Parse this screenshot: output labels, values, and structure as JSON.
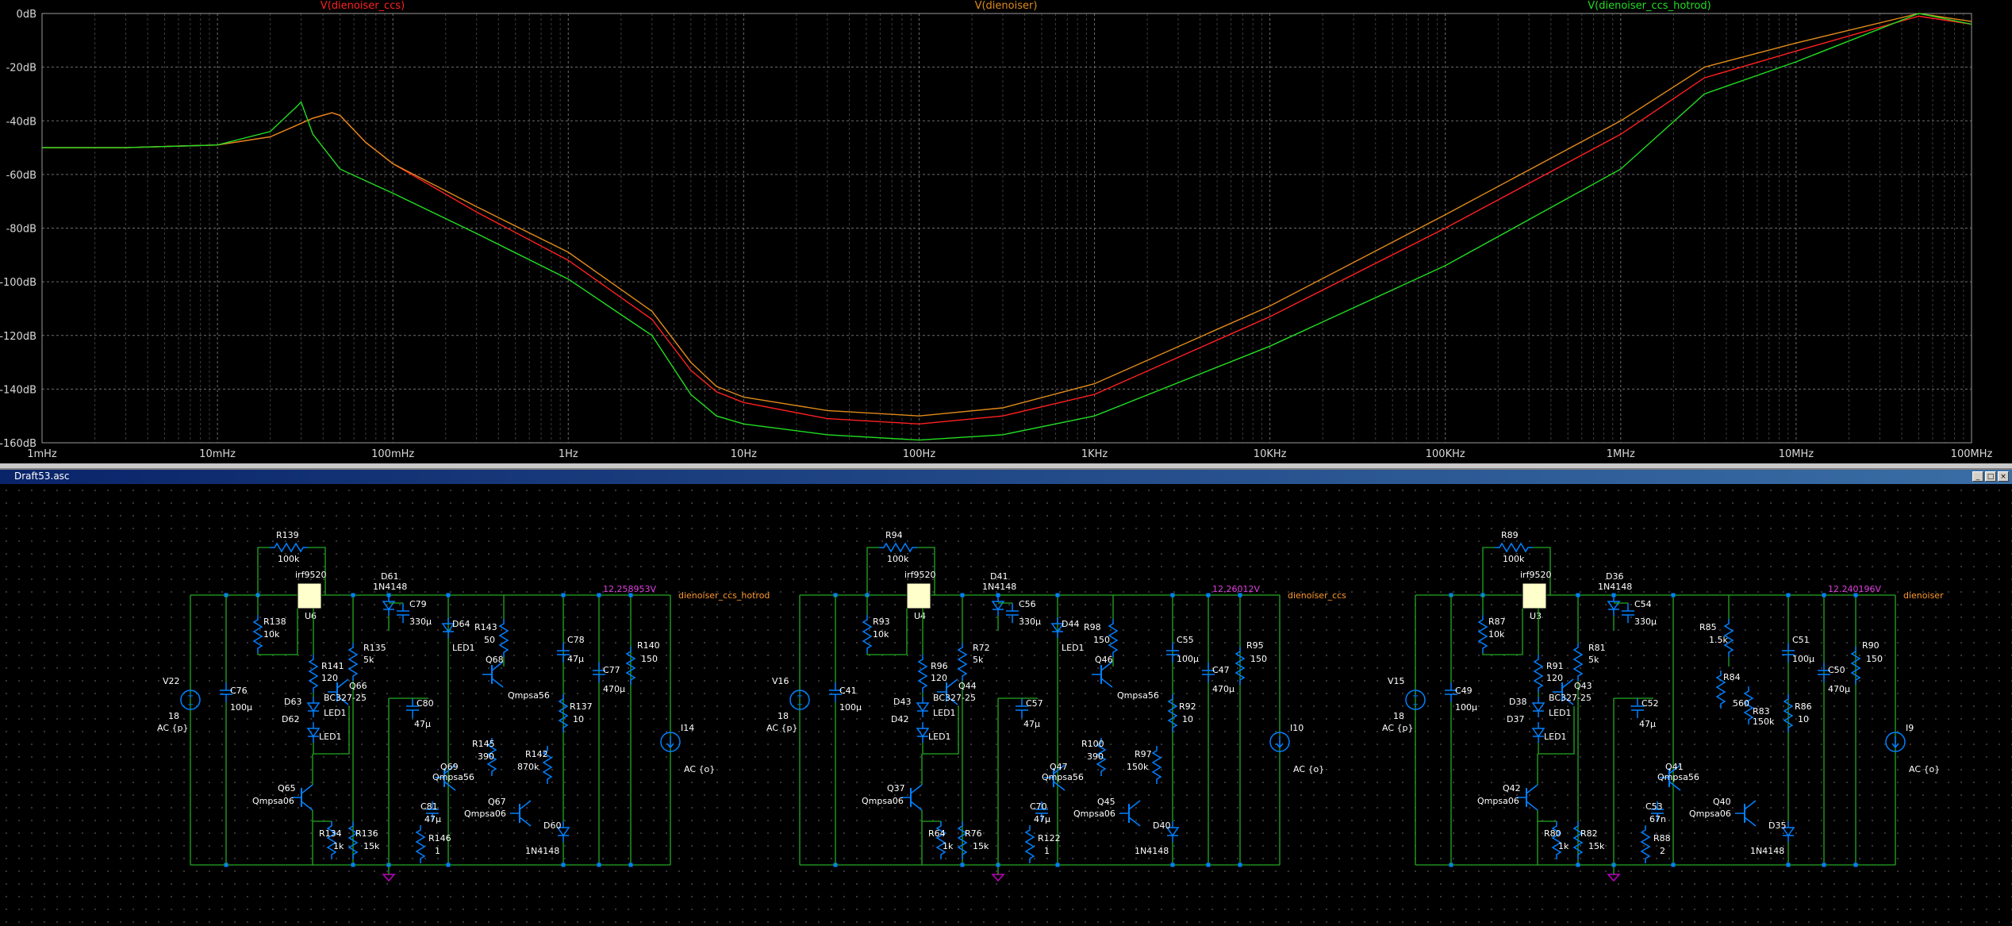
{
  "plot": {
    "traces": [
      {
        "name": "V(dienoiser_ccs)",
        "color": "#ff2020"
      },
      {
        "name": "V(dienoiser)",
        "color": "#e08a1a"
      },
      {
        "name": "V(dienoiser_ccs_hotrod)",
        "color": "#22dd22"
      }
    ],
    "y_ticks": [
      "0dB",
      "-20dB",
      "-40dB",
      "-60dB",
      "-80dB",
      "-100dB",
      "-120dB",
      "-140dB",
      "-160dB"
    ],
    "x_ticks": [
      "1mHz",
      "10mHz",
      "100mHz",
      "1Hz",
      "10Hz",
      "100Hz",
      "1KHz",
      "10KHz",
      "100KHz",
      "1MHz",
      "10MHz",
      "100MHz"
    ]
  },
  "chart_data": {
    "type": "line",
    "title": "",
    "xlabel": "",
    "ylabel": "",
    "x_scale": "log",
    "xlim": [
      "1mHz",
      "100MHz"
    ],
    "ylim": [
      -160,
      0
    ],
    "grid": true,
    "series": [
      {
        "name": "V(dienoiser_ccs)",
        "color": "#ff2020",
        "x": [
          0.001,
          0.003,
          0.01,
          0.02,
          0.035,
          0.045,
          0.05,
          0.07,
          0.1,
          0.3,
          1,
          3,
          5,
          7,
          10,
          30,
          100,
          300,
          1000,
          10000,
          100000,
          1000000,
          3000000,
          10000000,
          50000000,
          100000000
        ],
        "y": [
          -50,
          -50,
          -49,
          -46,
          -39,
          -37,
          -38,
          -48,
          -56,
          -74,
          -92,
          -114,
          -133,
          -141,
          -145,
          -151,
          -153,
          -150,
          -142,
          -113,
          -80,
          -45,
          -24,
          -14,
          -1,
          -4
        ]
      },
      {
        "name": "V(dienoiser)",
        "color": "#e08a1a",
        "x": [
          0.001,
          0.003,
          0.01,
          0.02,
          0.035,
          0.045,
          0.05,
          0.07,
          0.1,
          0.3,
          1,
          3,
          5,
          7,
          10,
          30,
          100,
          300,
          1000,
          10000,
          100000,
          1000000,
          3000000,
          10000000,
          50000000,
          100000000
        ],
        "y": [
          -50,
          -50,
          -49,
          -46,
          -39,
          -37,
          -38,
          -48,
          -56,
          -72,
          -89,
          -111,
          -130,
          -139,
          -143,
          -148,
          -150,
          -147,
          -138,
          -109,
          -75,
          -40,
          -20,
          -11,
          0,
          -3
        ]
      },
      {
        "name": "V(dienoiser_ccs_hotrod)",
        "color": "#22dd22",
        "x": [
          0.001,
          0.003,
          0.01,
          0.02,
          0.028,
          0.03,
          0.035,
          0.05,
          0.1,
          0.3,
          1,
          3,
          5,
          7,
          10,
          30,
          100,
          300,
          1000,
          10000,
          100000,
          1000000,
          3000000,
          10000000,
          50000000,
          100000000
        ],
        "y": [
          -50,
          -50,
          -49,
          -44,
          -35,
          -33,
          -45,
          -58,
          -67,
          -82,
          -99,
          -120,
          -142,
          -150,
          -153,
          -157,
          -159,
          -157,
          -150,
          -124,
          -94,
          -58,
          -30,
          -18,
          0,
          -4
        ]
      }
    ]
  },
  "window": {
    "title": "Draft53.asc",
    "min": "_",
    "restore": "□",
    "close": "×"
  },
  "circuits": [
    {
      "vsrc": "V22",
      "vsrc_val": "18",
      "vsrc_ac": "AC {p}",
      "rf": "R139",
      "rf_val": "100k",
      "mos": "irf9520",
      "mos_ref": "U6",
      "diode_top": "D61",
      "diode_top_val": "1N4148",
      "cin": "C76",
      "cin_val": "100μ",
      "rg": "R138",
      "rg_val": "10k",
      "r2": "R141",
      "r2_val": "120",
      "qp": "Q66",
      "qp_val": "BC327-25",
      "led_a": "D63",
      "led_a_val": "LED1",
      "led_b": "D62",
      "led_b_val": "LED1",
      "qn": "Q65",
      "qn_val": "Qmpsa06",
      "r_lo1": "R134",
      "r_lo1_val": "1k",
      "r_lo2": "R136",
      "r_lo2_val": "15k",
      "c_sup": "C79",
      "c_sup_val": "330μ",
      "r_sup": "R135",
      "r_sup_val": "5k",
      "c_mid": "C80",
      "c_mid_val": "47μ",
      "led_c": "D64",
      "led_c_val": "LED1",
      "r_top": "R143",
      "r_top_val": "50",
      "q_top": "Q68",
      "q_top_val": "Qmpsa56",
      "q_l": "Q69",
      "q_l_val": "Qmpsa56",
      "r_m1": "R145",
      "r_m1_val": "390",
      "r_m2": "R142",
      "r_m2_val": "870k",
      "q_r": "Q67",
      "q_r_val": "Qmpsa06",
      "c_lo": "C81",
      "c_lo_val": "47μ",
      "r_lo3": "R146",
      "r_lo3_val": "1",
      "d_out": "D60",
      "d_out_val": "1N4148",
      "c_o1": "C78",
      "c_o1_val": "47μ",
      "r_o1": "R137",
      "r_o1_val": "10",
      "c_o2": "C77",
      "c_o2_val": "470μ",
      "r_o2": "R140",
      "r_o2_val": "150",
      "isrc": "I14",
      "isrc_ac": "AC {o}",
      "vout": "12.258953V",
      "net": "dienoiser_ccs_hotrod"
    },
    {
      "vsrc": "V16",
      "vsrc_val": "18",
      "vsrc_ac": "AC {p}",
      "rf": "R94",
      "rf_val": "100k",
      "mos": "irf9520",
      "mos_ref": "U4",
      "diode_top": "D41",
      "diode_top_val": "1N4148",
      "cin": "C41",
      "cin_val": "100μ",
      "rg": "R93",
      "rg_val": "10k",
      "r2": "R96",
      "r2_val": "120",
      "qp": "Q44",
      "qp_val": "BC327-25",
      "led_a": "D43",
      "led_a_val": "LED1",
      "led_b": "D42",
      "led_b_val": "LED1",
      "qn": "Q37",
      "qn_val": "Qmpsa06",
      "r_lo1": "R64",
      "r_lo1_val": "1k",
      "r_lo2": "R76",
      "r_lo2_val": "15k",
      "c_sup": "C56",
      "c_sup_val": "330μ",
      "r_sup": "R72",
      "r_sup_val": "5k",
      "c_mid": "C57",
      "c_mid_val": "47μ",
      "led_c": "D44",
      "led_c_val": "LED1",
      "r_top": "R98",
      "r_top_val": "150",
      "q_top": "Q46",
      "q_top_val": "Qmpsa56",
      "q_l": "Q47",
      "q_l_val": "Qmpsa56",
      "r_m1": "R100",
      "r_m1_val": "390",
      "r_m2": "R97",
      "r_m2_val": "150k",
      "q_r": "Q45",
      "q_r_val": "Qmpsa06",
      "c_lo": "C70",
      "c_lo_val": "47μ",
      "r_lo3": "R122",
      "r_lo3_val": "1",
      "d_out": "D40",
      "d_out_val": "1N4148",
      "c_o1": "C55",
      "c_o1_val": "100μ",
      "r_o1": "R92",
      "r_o1_val": "10",
      "c_o2": "C47",
      "c_o2_val": "470μ",
      "r_o2": "R95",
      "r_o2_val": "150",
      "isrc": "I10",
      "isrc_ac": "AC {o}",
      "vout": "12.26012V",
      "net": "dienoiser_ccs"
    },
    {
      "vsrc": "V15",
      "vsrc_val": "18",
      "vsrc_ac": "AC {p}",
      "rf": "R89",
      "rf_val": "100k",
      "mos": "irf9520",
      "mos_ref": "U3",
      "diode_top": "D36",
      "diode_top_val": "1N4148",
      "cin": "C49",
      "cin_val": "100μ",
      "rg": "R87",
      "rg_val": "10k",
      "r2": "R91",
      "r2_val": "120",
      "qp": "Q43",
      "qp_val": "BC327-25",
      "led_a": "D38",
      "led_a_val": "LED1",
      "led_b": "D37",
      "led_b_val": "LED1",
      "qn": "Q42",
      "qn_val": "Qmpsa06",
      "r_lo1": "R80",
      "r_lo1_val": "1k",
      "r_lo2": "R82",
      "r_lo2_val": "15k",
      "c_sup": "C54",
      "c_sup_val": "330μ",
      "r_sup": "R81",
      "r_sup_val": "5k",
      "c_mid": "C52",
      "c_mid_val": "47μ",
      "r_top": "R85",
      "r_top_val": "1.5k",
      "r_a": "R84",
      "r_a_val": "560",
      "r_b": "R83",
      "r_b_val": "150k",
      "q_l": "Q41",
      "q_l_val": "Qmpsa56",
      "q_r": "Q40",
      "q_r_val": "Qmpsa06",
      "c_lo": "C53",
      "c_lo_val": "67n",
      "r_lo3": "R88",
      "r_lo3_val": "2",
      "d_out": "D35",
      "d_out_val": "1N4148",
      "c_o1": "C51",
      "c_o1_val": "100μ",
      "r_o1": "R86",
      "r_o1_val": "10",
      "c_o2": "C50",
      "c_o2_val": "470μ",
      "r_o2": "R90",
      "r_o2_val": "150",
      "isrc": "I9",
      "isrc_ac": "AC {o}",
      "vout": "12.240196V",
      "net": "dienoiser"
    }
  ]
}
